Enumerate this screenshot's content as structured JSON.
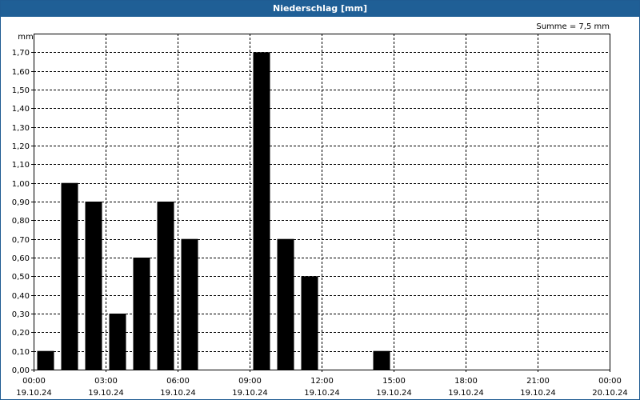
{
  "window": {
    "title": "Niederschlag [mm]"
  },
  "chart_data": {
    "type": "bar",
    "title": "Niederschlag [mm]",
    "ylabel": "mm",
    "annotation": "Summe = 7,5 mm",
    "ylim": [
      0,
      1.8
    ],
    "y_ticks": [
      "0,00",
      "0,10",
      "0,20",
      "0,30",
      "0,40",
      "0,50",
      "0,60",
      "0,70",
      "0,80",
      "0,90",
      "1,00",
      "1,10",
      "1,20",
      "1,30",
      "1,40",
      "1,50",
      "1,60",
      "1,70"
    ],
    "x_ticks": [
      {
        "time": "00:00",
        "date": "19.10.24"
      },
      {
        "time": "03:00",
        "date": "19.10.24"
      },
      {
        "time": "06:00",
        "date": "19.10.24"
      },
      {
        "time": "09:00",
        "date": "19.10.24"
      },
      {
        "time": "12:00",
        "date": "19.10.24"
      },
      {
        "time": "15:00",
        "date": "19.10.24"
      },
      {
        "time": "18:00",
        "date": "19.10.24"
      },
      {
        "time": "21:00",
        "date": "19.10.24"
      },
      {
        "time": "00:00",
        "date": "20.10.24"
      }
    ],
    "categories": [
      "00:00",
      "01:00",
      "02:00",
      "03:00",
      "04:00",
      "05:00",
      "06:00",
      "07:00",
      "08:00",
      "09:00",
      "10:00",
      "11:00",
      "12:00",
      "13:00",
      "14:00",
      "15:00",
      "16:00",
      "17:00",
      "18:00",
      "19:00",
      "20:00",
      "21:00",
      "22:00",
      "23:00"
    ],
    "values": [
      0.1,
      1.0,
      0.9,
      0.3,
      0.6,
      0.9,
      0.7,
      0,
      0,
      1.7,
      0.7,
      0.5,
      0,
      0,
      0.1,
      0,
      0,
      0,
      0,
      0,
      0,
      0,
      0,
      0
    ],
    "bar_color": "#000000",
    "grid": true
  }
}
